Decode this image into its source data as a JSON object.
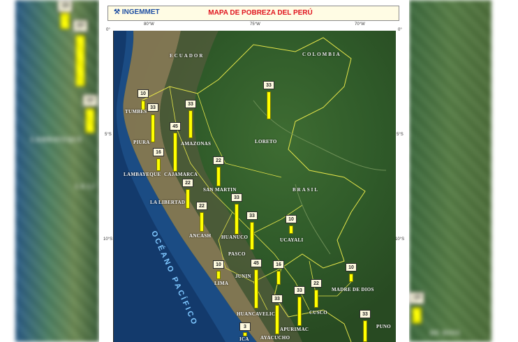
{
  "header": {
    "logo_text": "INGEMMET",
    "title": "MAPA DE POBREZA DEL PERÚ"
  },
  "axes": {
    "lon_labels": [
      "80°W",
      "75°W",
      "70°W"
    ],
    "lat_labels": [
      "0°",
      "5°S",
      "10°S"
    ]
  },
  "countries": [
    "ECUADOR",
    "COLOMBIA",
    "BRASIL"
  ],
  "ocean": "OCÉANO PACÍFICO",
  "departments": [
    {
      "name": "TUMBES",
      "value": "10"
    },
    {
      "name": "PIURA",
      "value": "33"
    },
    {
      "name": "LAMBAYEQUE",
      "value": "16"
    },
    {
      "name": "CAJAMARCA",
      "value": "45"
    },
    {
      "name": "AMAZONAS",
      "value": "33"
    },
    {
      "name": "LORETO",
      "value": "33"
    },
    {
      "name": "SAN MARTIN",
      "value": "22"
    },
    {
      "name": "LA LIBERTAD",
      "value": "22"
    },
    {
      "name": "ANCASH",
      "value": "22"
    },
    {
      "name": "HUANUCO",
      "value": "33"
    },
    {
      "name": "PASCO",
      "value": "33"
    },
    {
      "name": "UCAYALI",
      "value": "10"
    },
    {
      "name": "LIMA",
      "value": "10"
    },
    {
      "name": "JUNIN",
      "value": "16"
    },
    {
      "name": "HUANCAVELICA",
      "value": "45"
    },
    {
      "name": "ICA",
      "value": "3"
    },
    {
      "name": "AYACUCHO",
      "value": "33"
    },
    {
      "name": "APURIMAC",
      "value": "33"
    },
    {
      "name": "CUSCO",
      "value": "22"
    },
    {
      "name": "MADRE DE DIOS",
      "value": "10"
    },
    {
      "name": "PUNO",
      "value": "33"
    }
  ],
  "background_left": {
    "values": [
      "10",
      "33",
      "10"
    ],
    "labels": [
      "TUMBES",
      "LAMBAYEQUE",
      "LA LI"
    ]
  },
  "background_right": {
    "values": [
      "10"
    ],
    "labels": [
      "DE DIOS"
    ]
  },
  "colors": {
    "bar": "#ffff00",
    "title": "#e0141e",
    "logo": "#1f4fa3"
  }
}
